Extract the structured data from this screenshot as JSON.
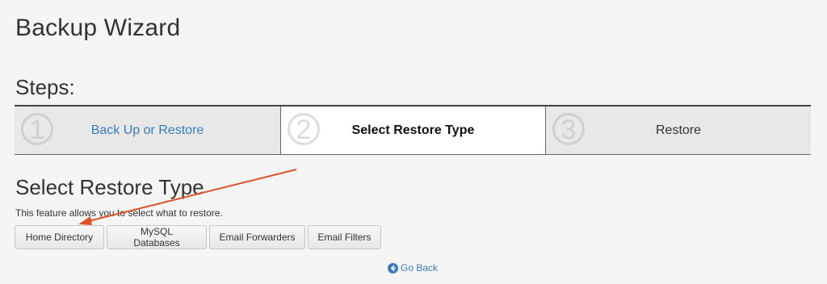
{
  "page": {
    "title": "Backup Wizard"
  },
  "steps": {
    "heading": "Steps:",
    "items": [
      {
        "number": "1",
        "label": "Back Up or Restore",
        "state": "link"
      },
      {
        "number": "2",
        "label": "Select Restore Type",
        "state": "current"
      },
      {
        "number": "3",
        "label": "Restore",
        "state": "upcoming"
      }
    ]
  },
  "section": {
    "title": "Select Restore Type",
    "description": "This feature allows you to select what to restore."
  },
  "buttons": {
    "home_directory": "Home Directory",
    "mysql_databases": "MySQL Databases",
    "email_forwarders": "Email Forwarders",
    "email_filters": "Email Filters"
  },
  "footer": {
    "go_back": "Go Back",
    "go_back_icon": "arrow-circle-left-icon"
  },
  "colors": {
    "link": "#3a7bbf",
    "annotation_arrow": "#e0502a"
  }
}
